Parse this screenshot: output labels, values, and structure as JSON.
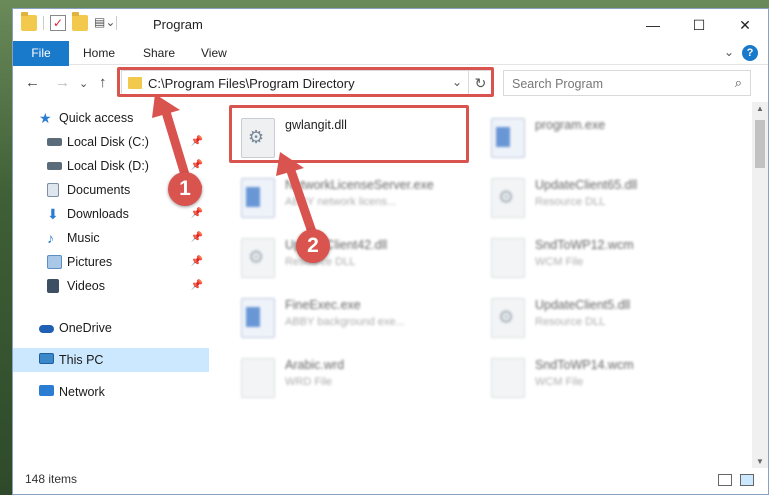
{
  "window": {
    "title": "Program",
    "controls": {
      "minimize": "—",
      "maximize": "☐",
      "close": "✕"
    }
  },
  "ribbon": {
    "tabs": [
      "File",
      "Home",
      "Share",
      "View"
    ],
    "help_glyph": "?",
    "collapse_glyph": "⌄"
  },
  "address": {
    "path": "C:\\Program Files\\Program Directory",
    "dropdown_glyph": "⌄",
    "refresh_glyph": "↻",
    "back_glyph": "←",
    "forward_glyph": "→",
    "recent_glyph": "⌄",
    "up_glyph": "↑"
  },
  "search": {
    "placeholder": "Search Program",
    "icon_glyph": "⌕"
  },
  "sidebar": {
    "items": [
      {
        "label": "Quick access",
        "icon": "star-icon",
        "color": "#2b7cd3",
        "pinned": false
      },
      {
        "label": "Local Disk (C:)",
        "icon": "drive-icon",
        "color": "#5a6b7a",
        "pinned": true
      },
      {
        "label": "Local Disk (D:)",
        "icon": "drive-icon",
        "color": "#5a6b7a",
        "pinned": true
      },
      {
        "label": "Documents",
        "icon": "documents-icon",
        "color": "#7d8fa3",
        "pinned": true
      },
      {
        "label": "Downloads",
        "icon": "downloads-icon",
        "color": "#2b7cd3",
        "pinned": true
      },
      {
        "label": "Music",
        "icon": "music-icon",
        "color": "#2b7cd3",
        "pinned": true
      },
      {
        "label": "Pictures",
        "icon": "pictures-icon",
        "color": "#5a8fc4",
        "pinned": true
      },
      {
        "label": "Videos",
        "icon": "videos-icon",
        "color": "#3c4f63",
        "pinned": true
      },
      {
        "label": "OneDrive",
        "icon": "onedrive-icon",
        "color": "#1f5fb4",
        "pinned": false
      },
      {
        "label": "This PC",
        "icon": "computer-icon",
        "color": "#3a87c9",
        "pinned": false
      },
      {
        "label": "Network",
        "icon": "network-icon",
        "color": "#2b7cd3",
        "pinned": false
      }
    ],
    "pin_glyph": "📌"
  },
  "files": {
    "left": [
      {
        "name": "gwlangit.dll",
        "type": "",
        "kind": "dll",
        "highlighted": true
      },
      {
        "name": "NetworkLicenseServer.exe",
        "type": "ABBY network licens...",
        "kind": "exe",
        "highlighted": false
      },
      {
        "name": "UpdateClient42.dll",
        "type": "Resource DLL",
        "kind": "dll",
        "highlighted": false
      },
      {
        "name": "FineExec.exe",
        "type": "ABBY background exe...",
        "kind": "exe",
        "highlighted": false
      },
      {
        "name": "Arabic.wrd",
        "type": "WRD File",
        "kind": "doc",
        "highlighted": false
      }
    ],
    "right": [
      {
        "name": "program.exe",
        "type": "",
        "kind": "exe"
      },
      {
        "name": "UpdateClient65.dll",
        "type": "Resource DLL",
        "kind": "dll"
      },
      {
        "name": "SndToWP12.wcm",
        "type": "WCM File",
        "kind": "doc"
      },
      {
        "name": "UpdateClient5.dll",
        "type": "Resource DLL",
        "kind": "dll"
      },
      {
        "name": "SndToWP14.wcm",
        "type": "WCM File",
        "kind": "doc"
      }
    ]
  },
  "annotations": {
    "step1": "1",
    "step2": "2",
    "color": "#d9534f"
  },
  "status": {
    "item_count": "148 items"
  }
}
